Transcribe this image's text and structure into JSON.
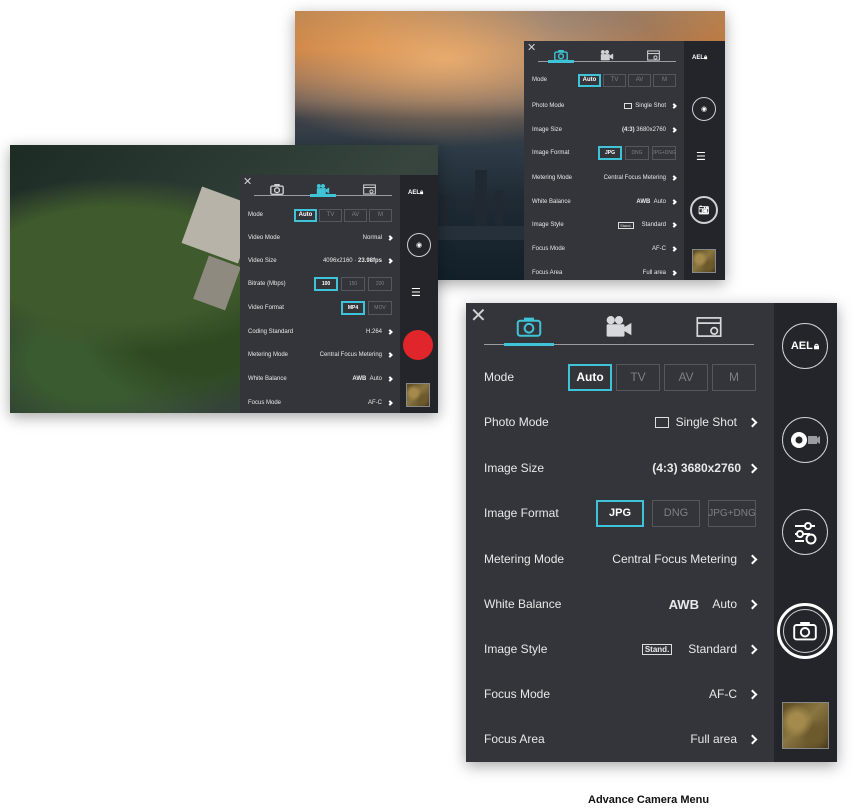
{
  "colors": {
    "accent": "#3ec4d6",
    "menu_bg": "#34353b",
    "rail_bg": "#24252a",
    "record": "#e0262b"
  },
  "caption": "Advance Camera Menu",
  "photo_menu": {
    "tabs": [
      "camera-icon",
      "video-camera-icon",
      "settings-window-icon"
    ],
    "mode_label": "Mode",
    "modes": [
      "Auto",
      "TV",
      "AV",
      "M"
    ],
    "rows": [
      {
        "label": "Photo Mode",
        "icon": "single-shot-icon",
        "value": "Single Shot"
      },
      {
        "label": "Image Size",
        "bold": "(4:3)",
        "value": "3680x2760"
      },
      {
        "label": "Image Format"
      },
      {
        "label": "Metering Mode",
        "value": "Central Focus Metering"
      },
      {
        "label": "White Balance",
        "bold": "AWB",
        "value": "Auto"
      },
      {
        "label": "Image Style",
        "badge": "Stand.",
        "value": "Standard"
      },
      {
        "label": "Focus Mode",
        "value": "AF-C"
      },
      {
        "label": "Focus Area",
        "value": "Full area"
      }
    ],
    "formats": [
      "JPG",
      "DNG",
      "JPG+DNG"
    ],
    "ael": "AEL"
  },
  "video_menu": {
    "mode_label": "Mode",
    "modes": [
      "Auto",
      "TV",
      "AV",
      "M"
    ],
    "video_mode": {
      "label": "Video Mode",
      "value": "Normal"
    },
    "video_size": {
      "label": "Video Size",
      "value": "4096x2160 ·",
      "bold": "23.98fps"
    },
    "bitrate": {
      "label": "Bitrate (Mbps)",
      "options": [
        "100",
        "150",
        "200"
      ]
    },
    "video_format": {
      "label": "Video Format",
      "options": [
        "MP4",
        "MOV"
      ]
    },
    "coding": {
      "label": "Coding Standard",
      "value": "H.264"
    },
    "metering": {
      "label": "Metering Mode",
      "value": "Central Focus Metering"
    },
    "white_balance": {
      "label": "White Balance",
      "bold": "AWB",
      "value": "Auto"
    },
    "focus_mode": {
      "label": "Focus Mode",
      "value": "AF-C"
    },
    "ael": "AEL"
  }
}
